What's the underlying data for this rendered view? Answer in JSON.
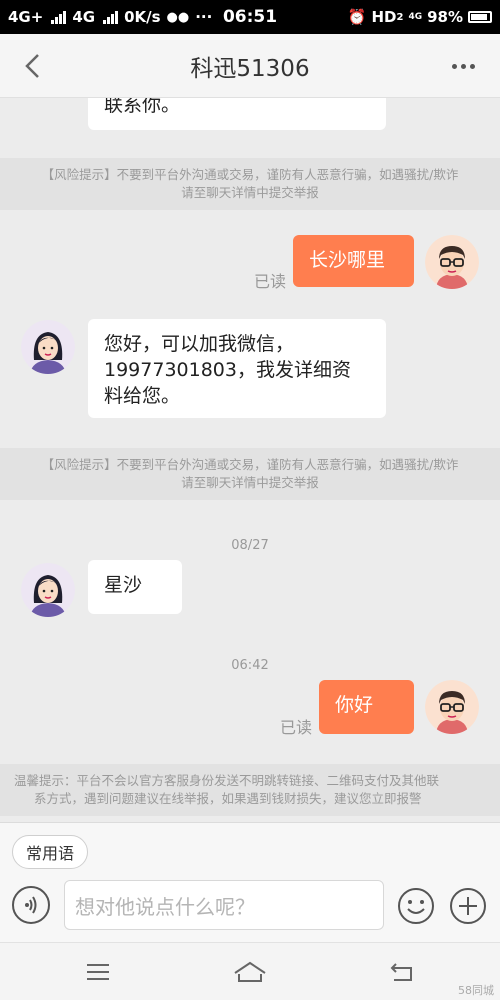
{
  "status_bar": {
    "network1": "4G+",
    "network2": "4G",
    "speed": "0K/s",
    "dots": "···",
    "time": "06:51",
    "hd": "HD",
    "hd_sub": "2",
    "net_small": "4G",
    "battery": "98%"
  },
  "header": {
    "title": "科迅51306"
  },
  "chat": {
    "msg_top": "联系你。",
    "risk_notice_line1": "【风险提示】不要到平台外沟通或交易，谨防有人恶意行骗，如遇骚扰/欺诈",
    "risk_notice_line2": "请至聊天详情中提交举报",
    "msg_changsha": "长沙哪里",
    "read_label": "已读",
    "msg_reply_line1": "您好，可以加我微信，",
    "msg_reply_line2": "19977301803，我发详细资",
    "msg_reply_line3": "料给您。",
    "date1": "08/27",
    "msg_xingsha": "星沙",
    "date2": "06:42",
    "msg_hello": "你好",
    "warm_line1": "温馨提示：平台不会以官方客服身份发送不明跳转链接、二维码支付及其他联",
    "warm_line2": "系方式，遇到问题建议在线举报，如果遇到钱财损失，建议您立即报警"
  },
  "input": {
    "common_phrases": "常用语",
    "placeholder": "想对他说点什么呢？"
  },
  "watermark": "58同城",
  "colors": {
    "accent": "#ff7e4f",
    "background": "#ececec",
    "notice_bg": "#e2e2e2"
  }
}
